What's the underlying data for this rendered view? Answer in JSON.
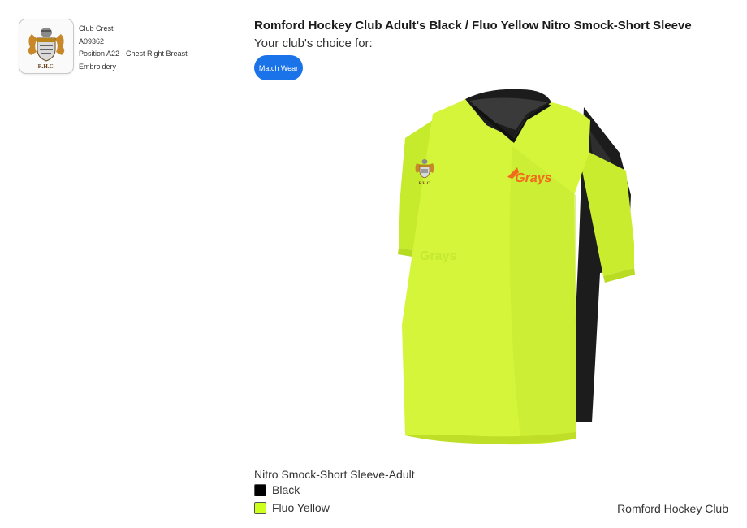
{
  "crest": {
    "initials": "R.H.C.",
    "lines": [
      "Club Crest",
      "A09362",
      "Position A22 - Chest Right Breast",
      "Embroidery"
    ]
  },
  "product": {
    "title": "Romford Hockey Club Adult's Black / Fluo Yellow Nitro Smock-Short Sleeve",
    "choice_label": "Your club's choice for:",
    "tag": "Match Wear",
    "brand_logo_text": "Grays",
    "variant_name": "Nitro Smock-Short Sleeve-Adult",
    "colours": [
      {
        "label": "Black",
        "hex": "#000000"
      },
      {
        "label": "Fluo Yellow",
        "hex": "#ccff1a"
      }
    ],
    "club_name": "Romford Hockey Club"
  },
  "colors": {
    "accent": "#1a73e8",
    "shirt_body": "#d4f53a",
    "shirt_trim": "#1c1c1c",
    "brand_orange": "#f26a1b"
  }
}
